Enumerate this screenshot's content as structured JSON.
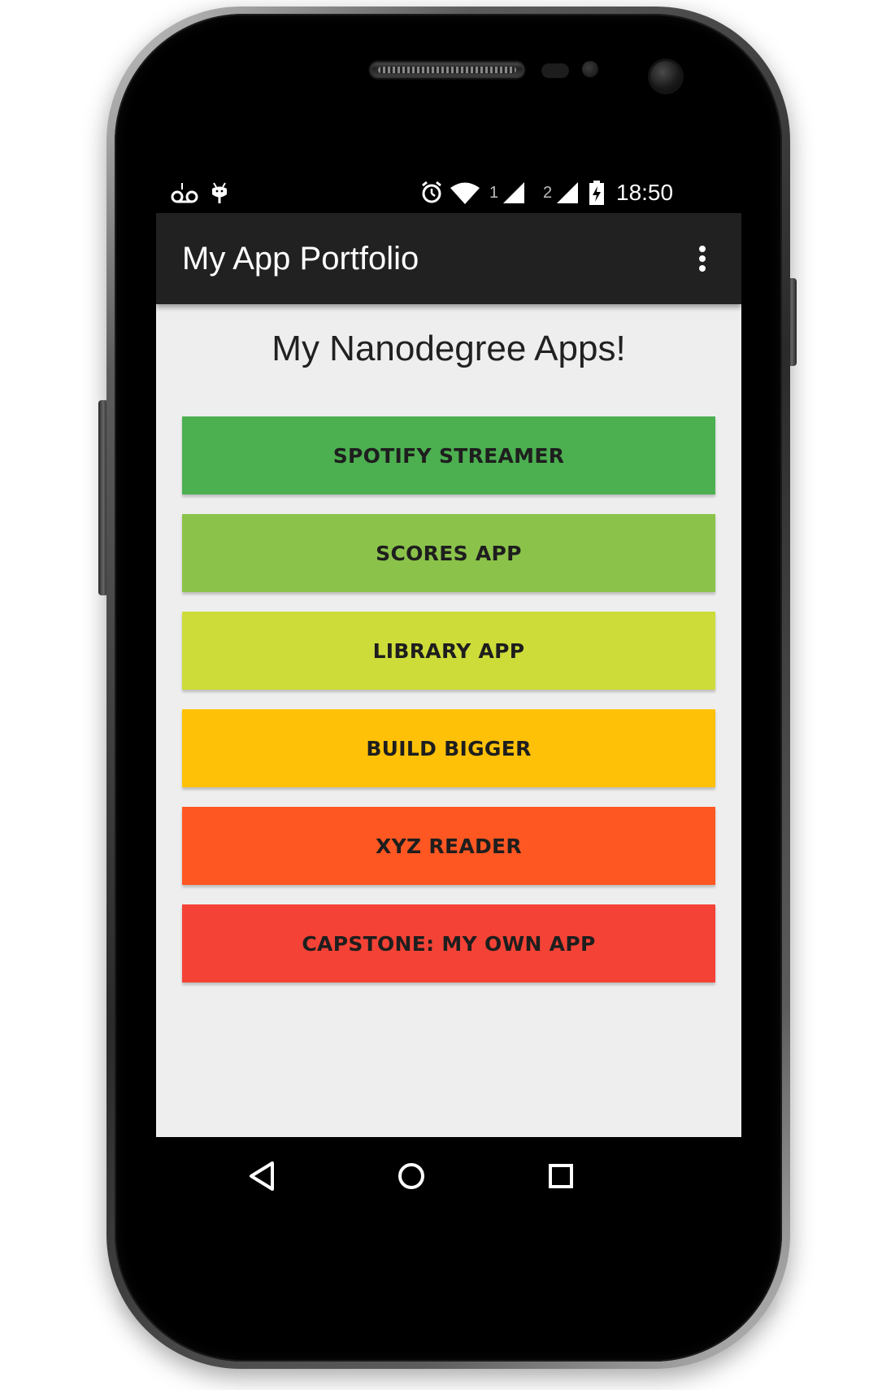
{
  "status_bar": {
    "time": "18:50",
    "sim1_label": "1",
    "sim2_label": "2",
    "icons": [
      "voicemail-icon",
      "android-debug-icon",
      "alarm-icon",
      "wifi-icon",
      "cell-signal-icon",
      "battery-charging-icon"
    ]
  },
  "app_bar": {
    "title": "My App Portfolio",
    "overflow_icon": "more-vert-icon"
  },
  "main": {
    "heading": "My Nanodegree Apps!",
    "buttons": [
      {
        "label": "SPOTIFY STREAMER",
        "color": "#4CAF50"
      },
      {
        "label": "SCORES APP",
        "color": "#8BC34A"
      },
      {
        "label": "LIBRARY APP",
        "color": "#CDDC39"
      },
      {
        "label": "BUILD BIGGER",
        "color": "#FFC107"
      },
      {
        "label": "XYZ READER",
        "color": "#FF5722"
      },
      {
        "label": "CAPSTONE: MY OWN APP",
        "color": "#F44336"
      }
    ]
  },
  "nav_bar": {
    "icons": [
      "back-icon",
      "home-icon",
      "recents-icon"
    ]
  },
  "theme": {
    "toolbar_color": "#212121",
    "background_color": "#EEEEEE"
  }
}
